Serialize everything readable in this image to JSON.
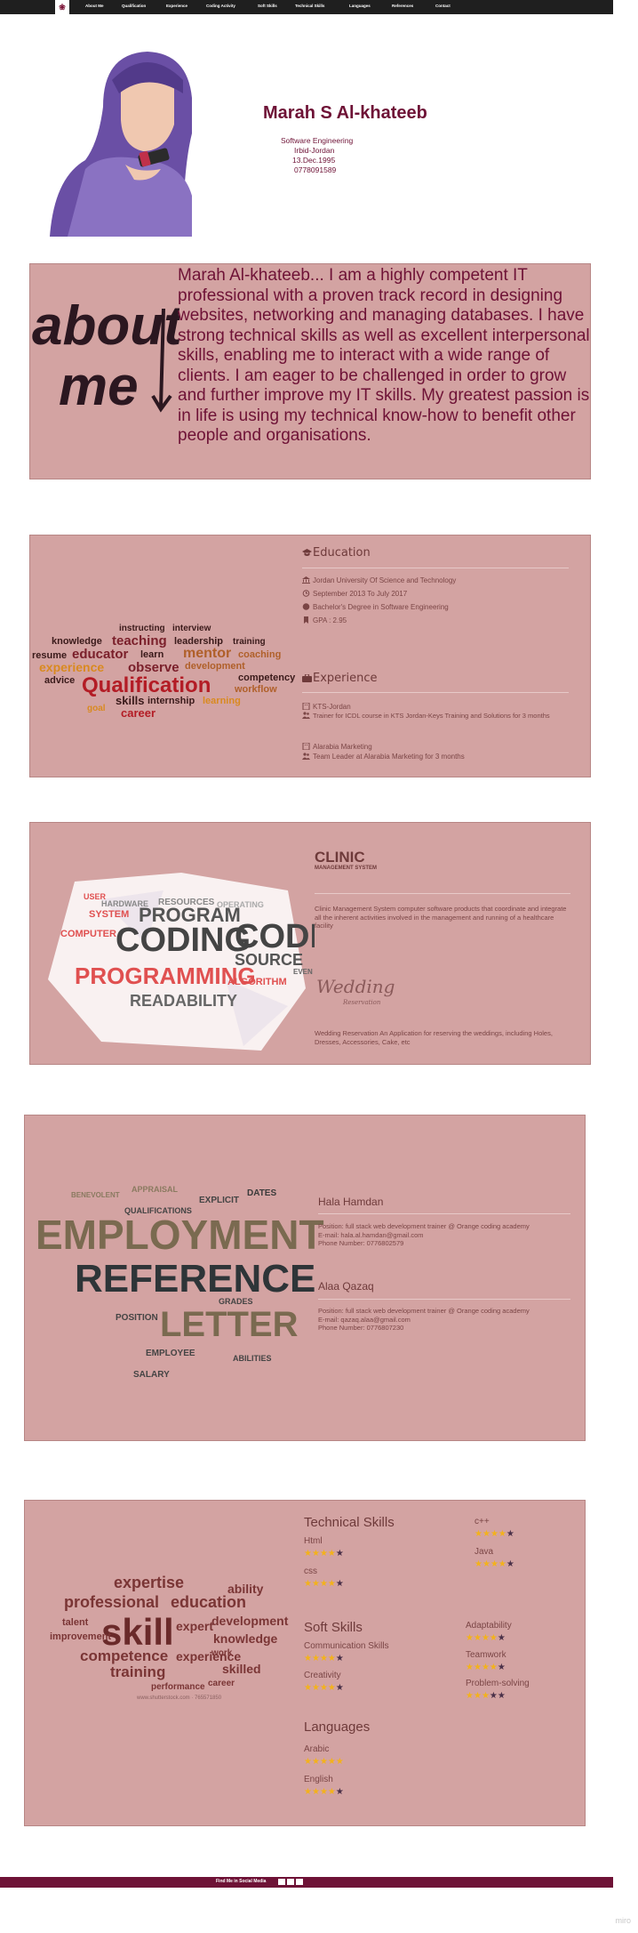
{
  "nav": {
    "logo": "❀",
    "items": [
      "About Me",
      "Qualification",
      "Experience",
      "Coding Activity",
      "Soft Skills",
      "Technical Skills",
      "Languages",
      "References",
      "Contact"
    ]
  },
  "hero": {
    "name": "Marah S Al-khateeb",
    "info": [
      "Software Engineering",
      "Irbid-Jordan",
      "13.Dec.1995",
      "0778091589"
    ]
  },
  "about": {
    "heading_art": [
      "about",
      "me"
    ],
    "text": "Marah Al-khateeb... I am a highly competent IT professional with a proven track record in designing websites, networking and managing databases. I have strong technical skills as well as excellent interpersonal skills, enabling me to interact with a wide range of clients. I am eager to be challenged in order to grow and further improve my IT skills. My greatest passion is in life is using my technical know-how to benefit other people and organisations."
  },
  "qualification": {
    "cloud_main": "Qualification",
    "cloud_words": [
      "instructing",
      "interview",
      "knowledge",
      "teaching",
      "leadership",
      "training",
      "resume",
      "educator",
      "learn",
      "mentor",
      "coaching",
      "experience",
      "observe",
      "development",
      "competency",
      "advice",
      "workflow",
      "skills",
      "internship",
      "learning",
      "goal",
      "career"
    ],
    "education_title": "Education",
    "education": [
      "Jordan University Of Science and Technology",
      "September 2013 To July 2017",
      "Bachelor's Degree in Software Engineering",
      "GPA : 2.95"
    ],
    "experience_title": "Experience",
    "experience": [
      {
        "company": "KTS-Jordan",
        "role": "Trainer for ICDL course in KTS Jordan-Keys Training and Solutions for 3 months"
      },
      {
        "company": "Alarabia Marketing",
        "role": "Team Leader at Alarabia Marketing for 3 months"
      }
    ]
  },
  "coding": {
    "cloud_words": [
      "SYSTEM",
      "HARDWARE",
      "PROGRAM",
      "RESOURCES",
      "OPERATING",
      "USER",
      "COMPUTER",
      "CODING",
      "CODE",
      "SOURCE",
      "PROGRAMMING",
      "READABILITY",
      "ALGORITHM",
      "EVEN"
    ],
    "project1_title": "CLINIC",
    "project1_sub": "MANAGEMENT SYSTEM",
    "project1_desc": "Clinic Management System computer software products that coordinate and integrate all the inherent activities involved in the management and running of a healthcare facility",
    "project2_title": "Wedding",
    "project2_sub": "Reservation",
    "project2_desc": "Wedding Reservation An Application for reserving the weddings, including Holes, Dresses, Accessories, Cake, etc"
  },
  "references": {
    "cloud_words": [
      "EMPLOYMENT",
      "REFERENCE",
      "LETTER",
      "APPRAISAL",
      "QUALIFICATIONS",
      "DATES",
      "EXPLICIT",
      "EMPLOYEE",
      "SALARY",
      "POSITION",
      "GRADES",
      "ABILITIES",
      "BENEVOLENT"
    ],
    "people": [
      {
        "name": "Hala Hamdan",
        "position": "Position: full stack web development trainer @ Orange coding academy",
        "email": "E-mail: hala.al.hamdan@gmail.com",
        "phone": "Phone Number: 0776802579"
      },
      {
        "name": "Alaa Qazaq",
        "position": "Position: full stack web development trainer @ Orange coding academy",
        "email": "E-mail: qazaq.alaa@gmail.com",
        "phone": "Phone Number: 0776807230"
      }
    ]
  },
  "skills": {
    "cloud_words": [
      "expertise",
      "professional",
      "education",
      "skill",
      "competence",
      "training",
      "experience",
      "expert",
      "development",
      "knowledge",
      "performance",
      "skilled",
      "ability",
      "talent",
      "improvement",
      "career",
      "work"
    ],
    "cloud_caption": "www.shutterstock.com · 765571850",
    "technical_title": "Technical Skills",
    "technical": [
      {
        "name": "Html",
        "rating": 4
      },
      {
        "name": "css",
        "rating": 4
      },
      {
        "name": "c++",
        "rating": 4
      },
      {
        "name": "Java",
        "rating": 4
      }
    ],
    "soft_title": "Soft Skills",
    "soft": [
      {
        "name": "Communication Skills",
        "rating": 4
      },
      {
        "name": "Creativity",
        "rating": 4
      },
      {
        "name": "Adaptability",
        "rating": 4
      },
      {
        "name": "Teamwork",
        "rating": 4
      },
      {
        "name": "Problem-solving",
        "rating": 3
      }
    ],
    "languages_title": "Languages",
    "languages": [
      {
        "name": "Arabic",
        "rating": 5
      },
      {
        "name": "English",
        "rating": 4
      }
    ]
  },
  "footer": {
    "text": "Find Me in Social Media",
    "icons": [
      "facebook-icon",
      "linkedin-icon",
      "github-icon"
    ]
  },
  "watermark": "miro",
  "colors": {
    "brand": "#6e1236",
    "section_bg": "#d3a3a2",
    "star": "#f3b21b"
  }
}
